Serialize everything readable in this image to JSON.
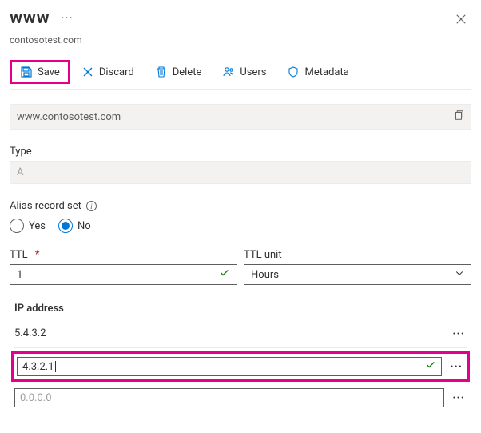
{
  "header": {
    "title": "www",
    "subtitle": "contosotest.com"
  },
  "toolbar": {
    "save_label": "Save",
    "discard_label": "Discard",
    "delete_label": "Delete",
    "users_label": "Users",
    "metadata_label": "Metadata"
  },
  "fqdn": {
    "value": "www.contosotest.com"
  },
  "type": {
    "label": "Type",
    "value": "A"
  },
  "alias": {
    "label": "Alias record set",
    "yes_label": "Yes",
    "no_label": "No",
    "selected": "No"
  },
  "ttl": {
    "label": "TTL",
    "value": "1",
    "unit_label": "TTL unit",
    "unit_value": "Hours"
  },
  "ip": {
    "header": "IP address",
    "rows": [
      {
        "value": "5.4.3.2",
        "kind": "static"
      },
      {
        "value": "4.3.2.1",
        "kind": "editing"
      },
      {
        "value": "0.0.0.0",
        "kind": "placeholder"
      }
    ]
  },
  "colors": {
    "highlight": "#e3008c",
    "primary": "#0078d4",
    "success": "#107c10"
  }
}
